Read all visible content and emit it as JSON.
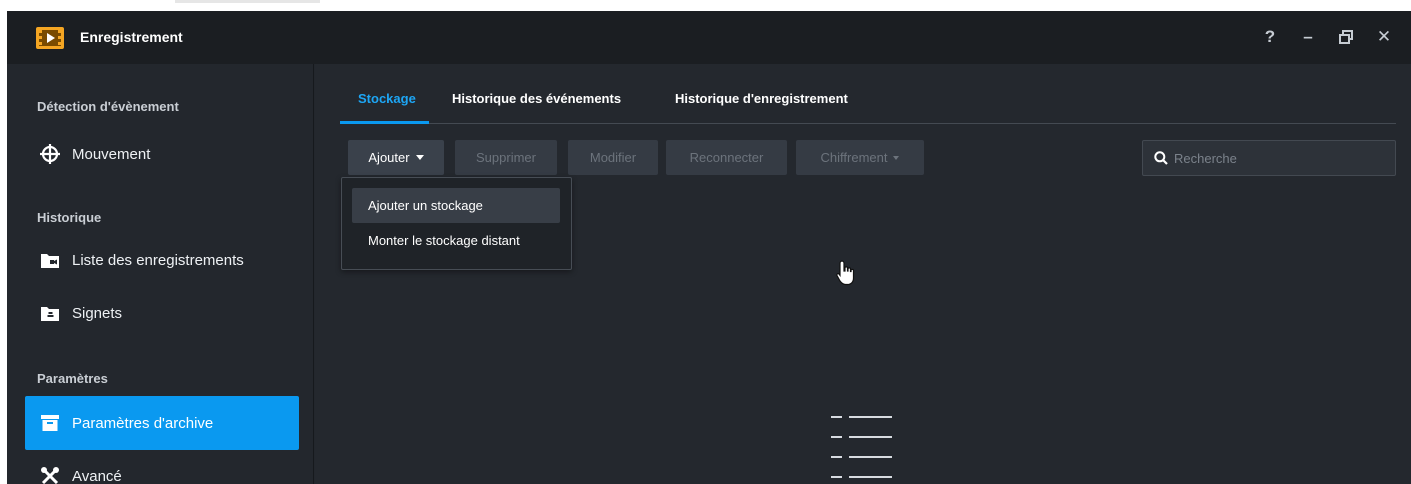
{
  "window": {
    "title": "Enregistrement",
    "controls": {
      "help": "?",
      "minimize": "–",
      "restore": "❐",
      "close": "✕"
    }
  },
  "sidebar": {
    "sections": [
      {
        "label": "Détection d'évènement"
      },
      {
        "label": "Historique"
      },
      {
        "label": "Paramètres"
      }
    ],
    "items": [
      {
        "label": "Mouvement",
        "icon": "crosshair-icon"
      },
      {
        "label": "Liste des enregistrements",
        "icon": "folder-video-icon"
      },
      {
        "label": "Signets",
        "icon": "folder-bookmark-icon"
      },
      {
        "label": "Paramètres d'archive",
        "icon": "archive-icon",
        "active": true
      },
      {
        "label": "Avancé",
        "icon": "tools-icon"
      }
    ]
  },
  "tabs": [
    {
      "label": "Stockage",
      "active": true
    },
    {
      "label": "Historique des événements"
    },
    {
      "label": "Historique d'enregistrement"
    }
  ],
  "toolbar": {
    "add": "Ajouter",
    "delete": "Supprimer",
    "edit": "Modifier",
    "reconnect": "Reconnecter",
    "encryption": "Chiffrement"
  },
  "search": {
    "placeholder": "Recherche"
  },
  "dropdown": {
    "items": [
      {
        "label": "Ajouter un stockage"
      },
      {
        "label": "Monter le stockage distant"
      }
    ]
  },
  "colors": {
    "accent": "#0a99f0",
    "background": "#23272d",
    "titlebar": "#1b1e22"
  }
}
